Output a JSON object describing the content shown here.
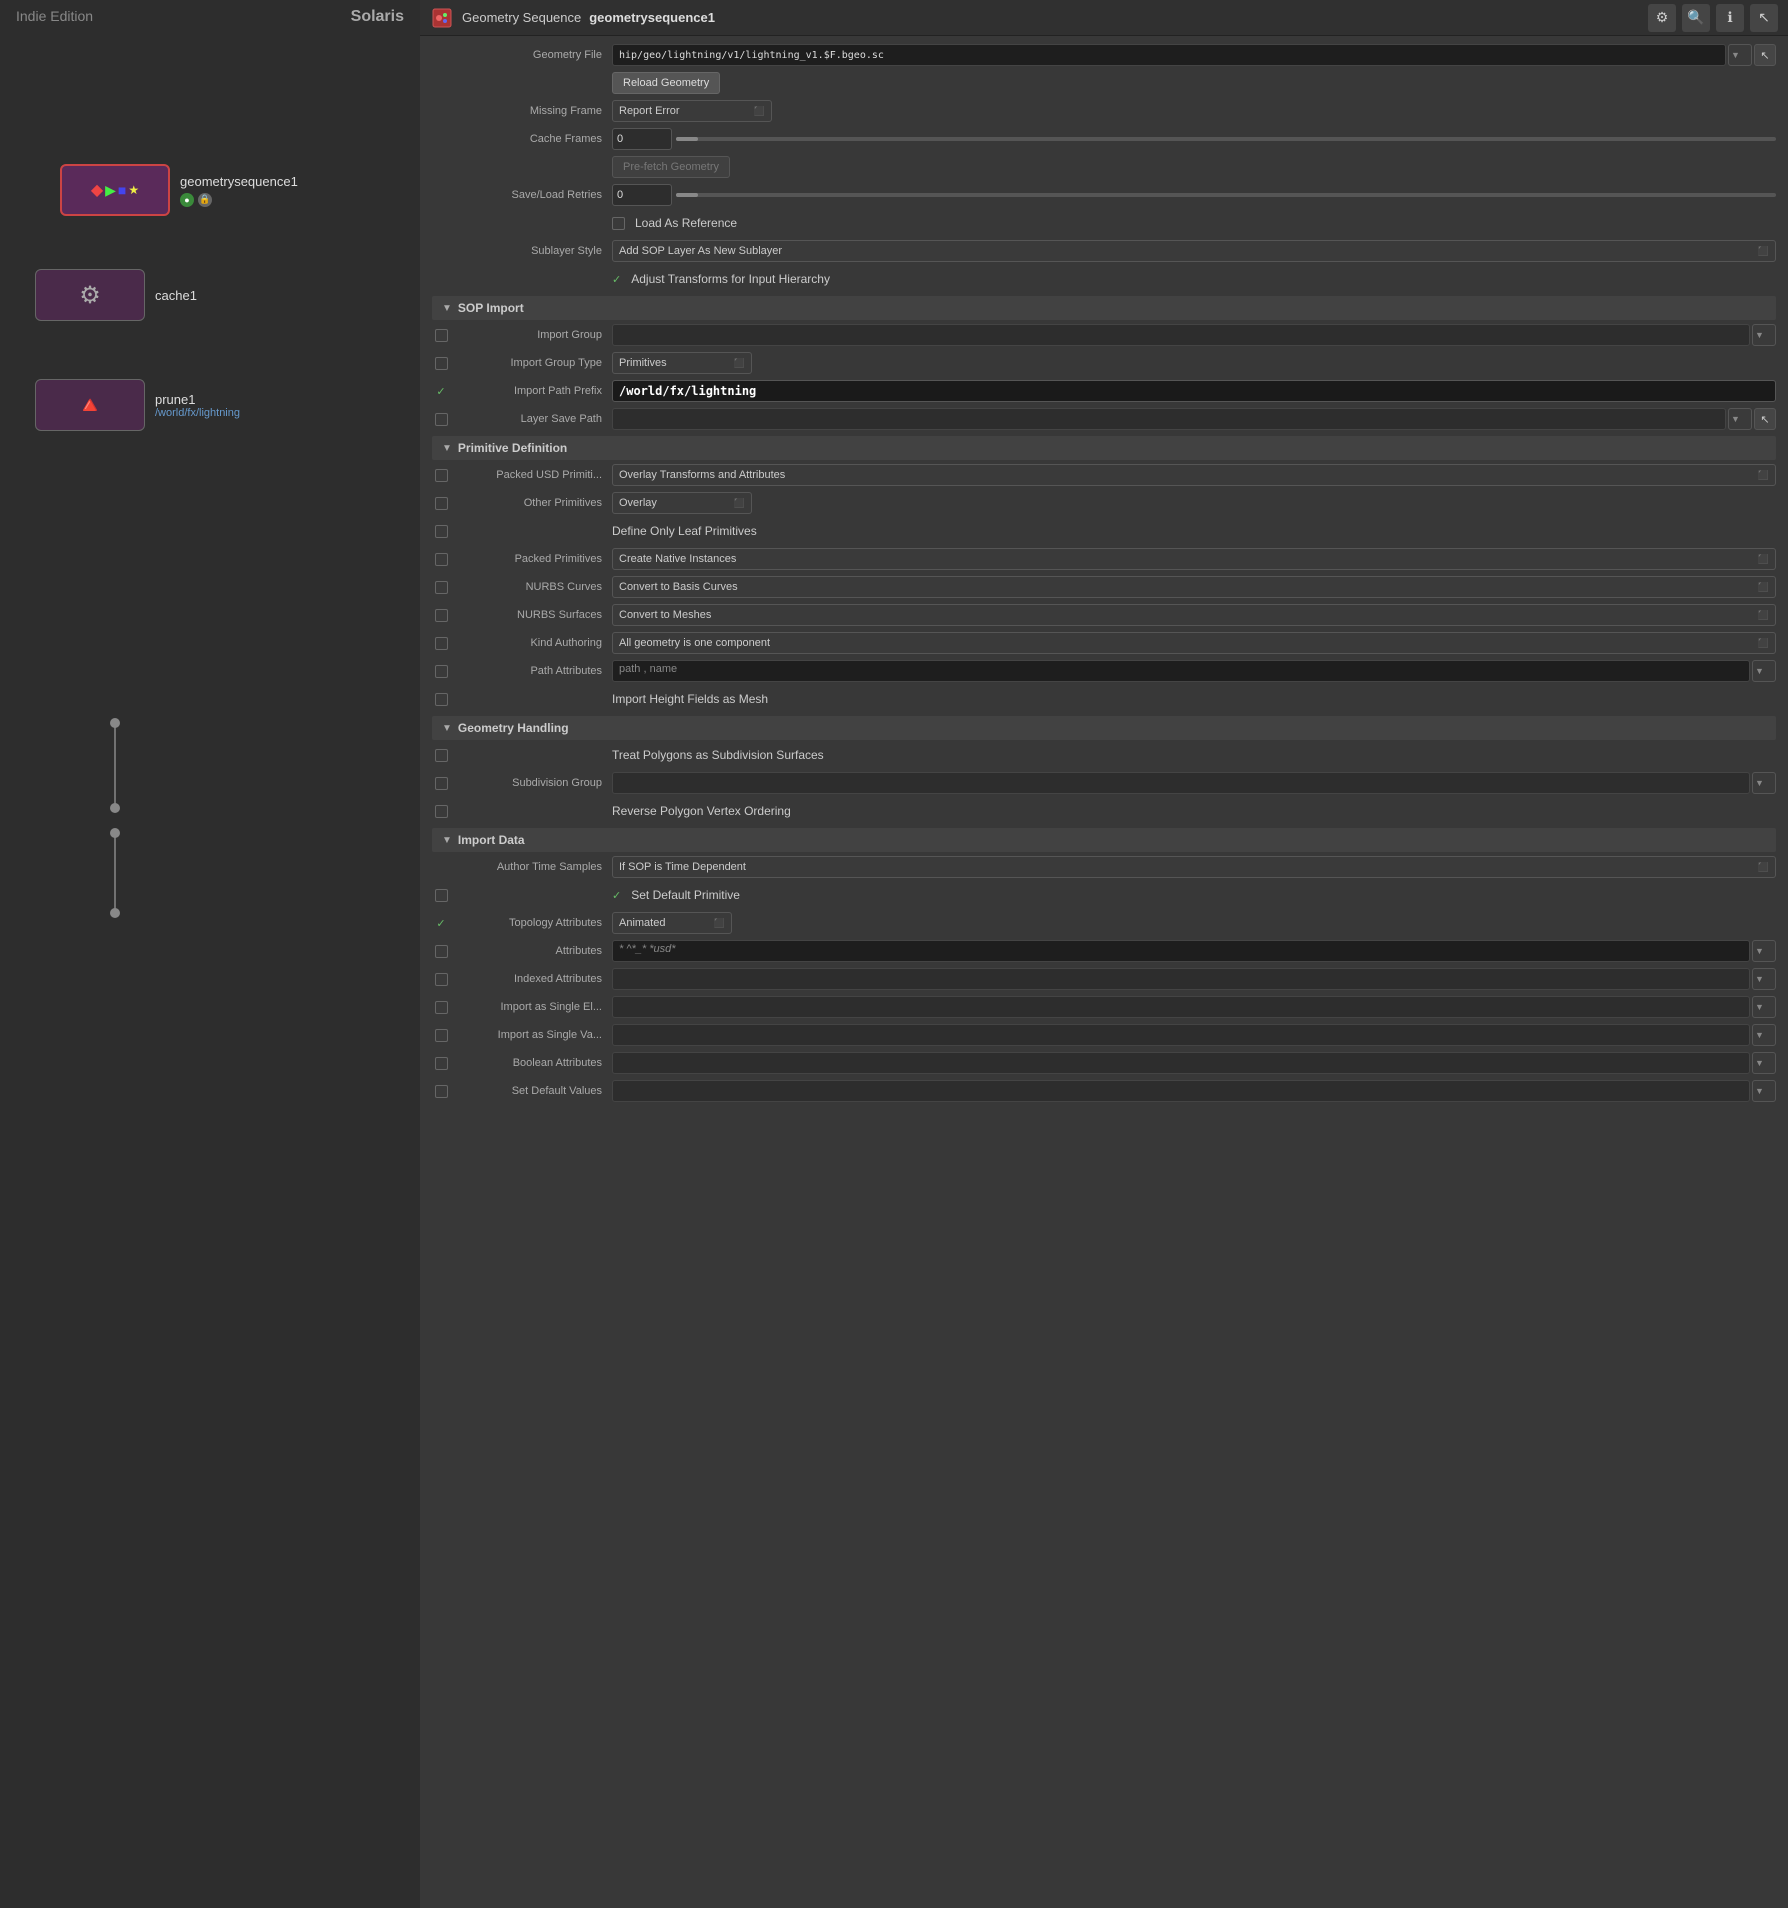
{
  "app": {
    "edition": "Indie Edition",
    "context": "Solaris"
  },
  "titlebar": {
    "panel_name": "Geometry Sequence",
    "node_name": "geometrysequence1",
    "buttons": [
      "⚙",
      "🔍",
      "ℹ"
    ]
  },
  "nodes": [
    {
      "id": "geo",
      "label": "geometrysequence1",
      "sublabel": "",
      "type": "geo"
    },
    {
      "id": "cache",
      "label": "cache1",
      "sublabel": "",
      "type": "cache"
    },
    {
      "id": "prune",
      "label": "prune1",
      "sublabel": "/world/fx/lightning",
      "type": "prune"
    }
  ],
  "fields": {
    "geometry_file": {
      "label": "Geometry File",
      "value": "hip/geo/lightning/v1/lightning_v1.$F.bgeo.sc"
    },
    "reload_geometry_btn": "Reload Geometry",
    "missing_frame": {
      "label": "Missing Frame",
      "value": "Report Error"
    },
    "cache_frames": {
      "label": "Cache Frames",
      "value": "0"
    },
    "prefetch_geometry_btn": "Pre-fetch Geometry",
    "save_load_retries": {
      "label": "Save/Load Retries",
      "value": "0"
    },
    "load_as_reference_cb": false,
    "load_as_reference_label": "Load As Reference",
    "sublayer_style": {
      "label": "Sublayer Style",
      "value": "Add SOP Layer As New Sublayer"
    },
    "adjust_transforms_cb": true,
    "adjust_transforms_label": "Adjust Transforms for Input Hierarchy"
  },
  "sections": {
    "sop_import": {
      "title": "SOP Import",
      "expanded": true,
      "fields": {
        "import_group": {
          "label": "Import Group",
          "cb": false,
          "value": ""
        },
        "import_group_type": {
          "label": "Import Group Type",
          "cb": false,
          "value": "Primitives"
        },
        "import_path_prefix": {
          "label": "Import Path Prefix",
          "cb": true,
          "value": "/world/fx/lightning"
        },
        "layer_save_path": {
          "label": "Layer Save Path",
          "cb": false,
          "value": ""
        }
      }
    },
    "primitive_definition": {
      "title": "Primitive Definition",
      "expanded": true,
      "fields": {
        "packed_usd": {
          "label": "Packed USD Primiti...",
          "cb": false,
          "value": "Overlay Transforms and Attributes"
        },
        "other_primitives": {
          "label": "Other Primitives",
          "cb": false,
          "value": "Overlay"
        },
        "define_only_leaf": {
          "label": "",
          "cb": false,
          "value": "Define Only Leaf Primitives"
        },
        "packed_primitives": {
          "label": "Packed Primitives",
          "cb": false,
          "value": "Create Native Instances"
        },
        "nurbs_curves": {
          "label": "NURBS Curves",
          "cb": false,
          "value": "Convert to Basis Curves"
        },
        "nurbs_surfaces": {
          "label": "NURBS Surfaces",
          "cb": false,
          "value": "Convert to Meshes"
        },
        "kind_authoring": {
          "label": "Kind Authoring",
          "cb": false,
          "value": "All geometry is one component"
        },
        "path_attributes": {
          "label": "Path Attributes",
          "cb": false,
          "value": "path , name"
        },
        "import_height_fields": {
          "label": "",
          "cb": false,
          "value": "Import Height Fields as Mesh"
        }
      }
    },
    "geometry_handling": {
      "title": "Geometry Handling",
      "expanded": true,
      "fields": {
        "treat_polygons": {
          "label": "",
          "cb": false,
          "value": "Treat Polygons as Subdivision Surfaces"
        },
        "subdivision_group": {
          "label": "Subdivision Group",
          "cb": false,
          "value": ""
        },
        "reverse_polygon": {
          "label": "",
          "cb": false,
          "value": "Reverse Polygon Vertex Ordering"
        }
      }
    },
    "import_data": {
      "title": "Import Data",
      "expanded": true,
      "fields": {
        "author_time_samples": {
          "label": "Author Time Samples",
          "cb": false,
          "value": "If SOP is Time Dependent"
        },
        "set_default_primitive": {
          "label": "",
          "cb": true,
          "value": "Set Default Primitive"
        },
        "topology_attributes": {
          "label": "Topology Attributes",
          "cb": true,
          "value": "Animated"
        },
        "attributes": {
          "label": "Attributes",
          "cb": false,
          "value": "* ^*_* *usd*"
        },
        "indexed_attributes": {
          "label": "Indexed Attributes",
          "cb": false,
          "value": ""
        },
        "import_as_single_el": {
          "label": "Import as Single El...",
          "cb": false,
          "value": ""
        },
        "import_as_single_va": {
          "label": "Import as Single Va...",
          "cb": false,
          "value": ""
        },
        "boolean_attributes": {
          "label": "Boolean Attributes",
          "cb": false,
          "value": ""
        },
        "set_default_values": {
          "label": "Set Default Values",
          "cb": false,
          "value": ""
        }
      }
    }
  }
}
